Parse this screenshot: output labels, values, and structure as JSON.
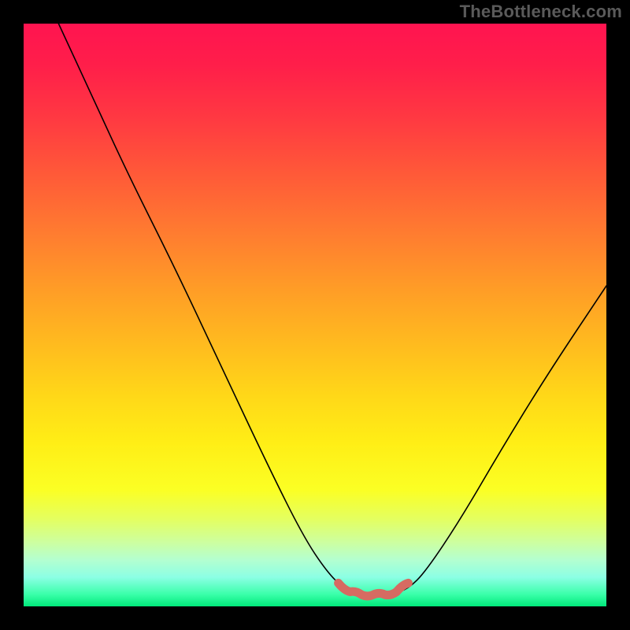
{
  "watermark": {
    "text": "TheBottleneck.com"
  },
  "chart_data": {
    "type": "line",
    "title": "",
    "xlabel": "",
    "ylabel": "",
    "xlim": [
      0,
      100
    ],
    "ylim": [
      0,
      100
    ],
    "grid": false,
    "legend": false,
    "series": [
      {
        "name": "bottleneck-curve",
        "color": "#000000",
        "points": [
          {
            "x": 6,
            "y": 100
          },
          {
            "x": 12,
            "y": 87
          },
          {
            "x": 18,
            "y": 74
          },
          {
            "x": 26,
            "y": 58
          },
          {
            "x": 34,
            "y": 41
          },
          {
            "x": 42,
            "y": 24
          },
          {
            "x": 48,
            "y": 12
          },
          {
            "x": 52,
            "y": 6
          },
          {
            "x": 55,
            "y": 3
          },
          {
            "x": 57,
            "y": 2
          },
          {
            "x": 60,
            "y": 2
          },
          {
            "x": 63,
            "y": 2
          },
          {
            "x": 66,
            "y": 3
          },
          {
            "x": 69,
            "y": 6
          },
          {
            "x": 75,
            "y": 15
          },
          {
            "x": 82,
            "y": 27
          },
          {
            "x": 90,
            "y": 40
          },
          {
            "x": 100,
            "y": 55
          }
        ]
      },
      {
        "name": "optimal-highlight",
        "color": "#d66b62",
        "points": [
          {
            "x": 54,
            "y": 4
          },
          {
            "x": 56,
            "y": 2.5
          },
          {
            "x": 58,
            "y": 2
          },
          {
            "x": 60,
            "y": 2
          },
          {
            "x": 62,
            "y": 2
          },
          {
            "x": 64,
            "y": 2.5
          },
          {
            "x": 66,
            "y": 4
          }
        ]
      }
    ]
  }
}
